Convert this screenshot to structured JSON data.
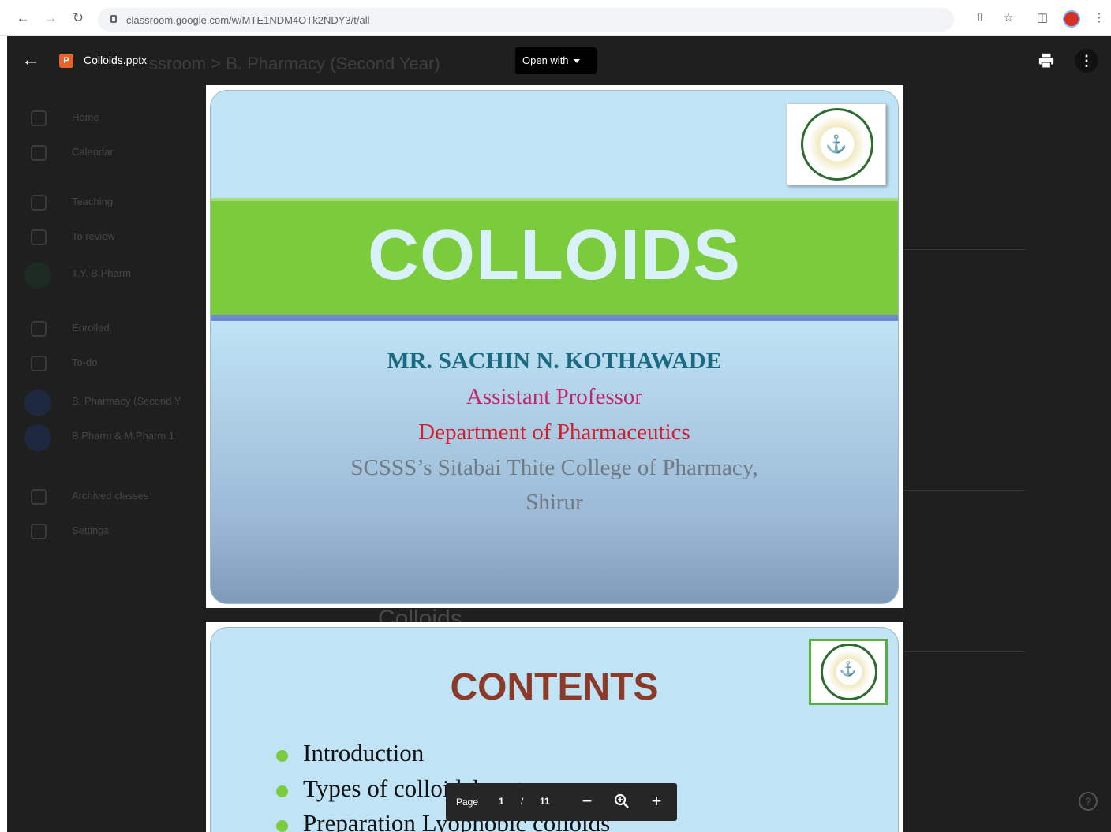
{
  "browser": {
    "url": "classroom.google.com/w/MTE1NDM4OTk2NDY3/t/all"
  },
  "viewer": {
    "file_name": "Colloids.pptx",
    "file_icon_letter": "P",
    "open_with_label": "Open with",
    "more_label": "⋮"
  },
  "background": {
    "breadcrumb": "ssroom  >  B. Pharmacy (Second Year)",
    "nav": [
      "Home",
      "Calendar",
      "Teaching",
      "To review",
      "T.Y. B.Pharm",
      "Enrolled",
      "To-do",
      "B. Pharmacy (Second Y",
      "B.Pharm & M.Pharm 1",
      "Archived classes",
      "Settings"
    ],
    "section_heading": "Colloids"
  },
  "slide1": {
    "title": "COLLOIDS",
    "author": "MR. SACHIN N. KOTHAWADE",
    "designation": "Assistant Professor",
    "department": "Department of Pharmaceutics",
    "college_line1": "SCSSS’s Sitabai Thite College of Pharmacy,",
    "college_line2": "Shirur"
  },
  "slide2": {
    "title": "CONTENTS",
    "bullets": [
      "Introduction",
      "Types of colloidal systems",
      "Preparation Lyophobic colloids"
    ]
  },
  "toolbar": {
    "page_label": "Page",
    "current_page": "1",
    "separator": "/",
    "total_pages": "11",
    "zoom_out": "−",
    "zoom_in": "+"
  },
  "colors": {
    "slide_sky": "#c0e3f5",
    "slide_green": "#7bcc3d",
    "contents_brown": "#8b3a2a",
    "viewer_dark": "#1f1f1f"
  }
}
